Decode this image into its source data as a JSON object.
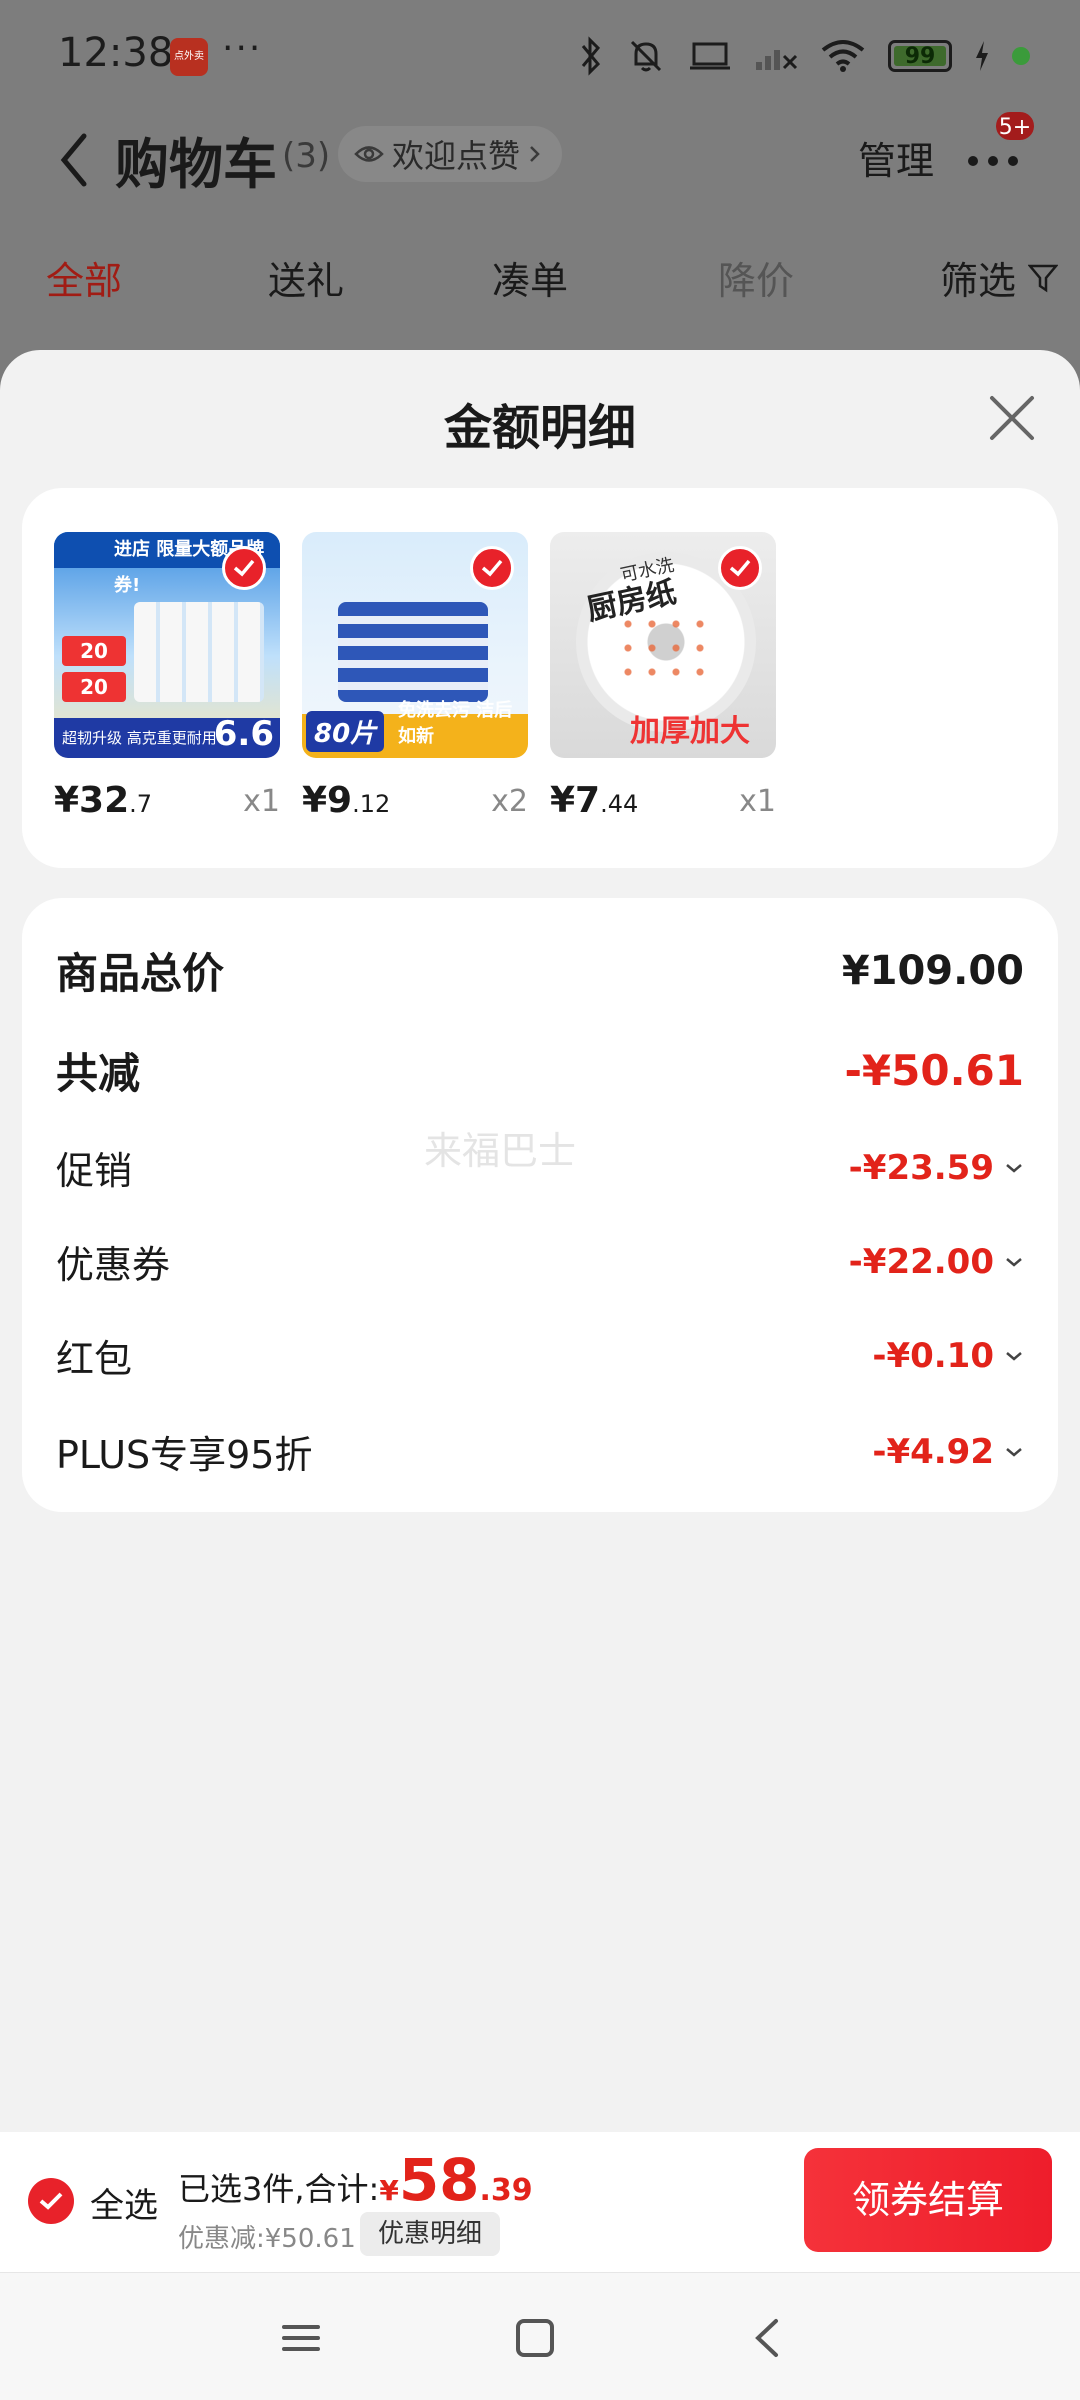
{
  "status_bar": {
    "time": "12:38",
    "app_icon_text": "点外卖",
    "more_dots": "···",
    "battery": "99"
  },
  "cart": {
    "title": "购物车",
    "count": "(3)",
    "fav_label": "欢迎点赞",
    "manage_label": "管理",
    "badge": "5+"
  },
  "tabs": [
    {
      "label": "全部"
    },
    {
      "label": "送礼"
    },
    {
      "label": "凑单"
    },
    {
      "label": "降价"
    },
    {
      "label": "筛选"
    }
  ],
  "sheet": {
    "title": "金额明细",
    "products": [
      {
        "price_int": "¥32",
        "price_dec": ".7",
        "qty": "x1",
        "img_banner": "进店 限量大额品牌券!",
        "img_tag_a": "20",
        "img_tag_b": "20",
        "img_bottom": "超韧升级 高克重更耐用",
        "img_discount": "6.6"
      },
      {
        "price_int": "¥9",
        "price_dec": ".12",
        "qty": "x2",
        "img_badge": "80片",
        "img_slogan": "免洗去污 洁后如新"
      },
      {
        "price_int": "¥7",
        "price_dec": ".44",
        "qty": "x1",
        "img_label_small": "可水洗",
        "img_label": "厨房纸",
        "img_thick": "加厚加大"
      }
    ],
    "details": {
      "total_label": "商品总价",
      "total_value": "¥109.00",
      "reduce_label": "共减",
      "reduce_value": "-¥50.61",
      "promo_label": "促销",
      "promo_value": "-¥23.59",
      "coupon_label": "优惠券",
      "coupon_value": "-¥22.00",
      "redpacket_label": "红包",
      "redpacket_value": "-¥0.10",
      "plus_label": "PLUS专享95折",
      "plus_value": "-¥4.92",
      "watermark": "来福巴士"
    }
  },
  "checkout": {
    "select_all": "全选",
    "summary_prefix": "已选3件,合计:",
    "currency": "¥",
    "total_int": "58",
    "total_dec": ".39",
    "saved": "优惠减:¥50.61",
    "detail_chip": "优惠明细",
    "pay_button": "领券结算"
  },
  "colors": {
    "accent_red": "#e2231a",
    "check_red": "#e8222a"
  }
}
